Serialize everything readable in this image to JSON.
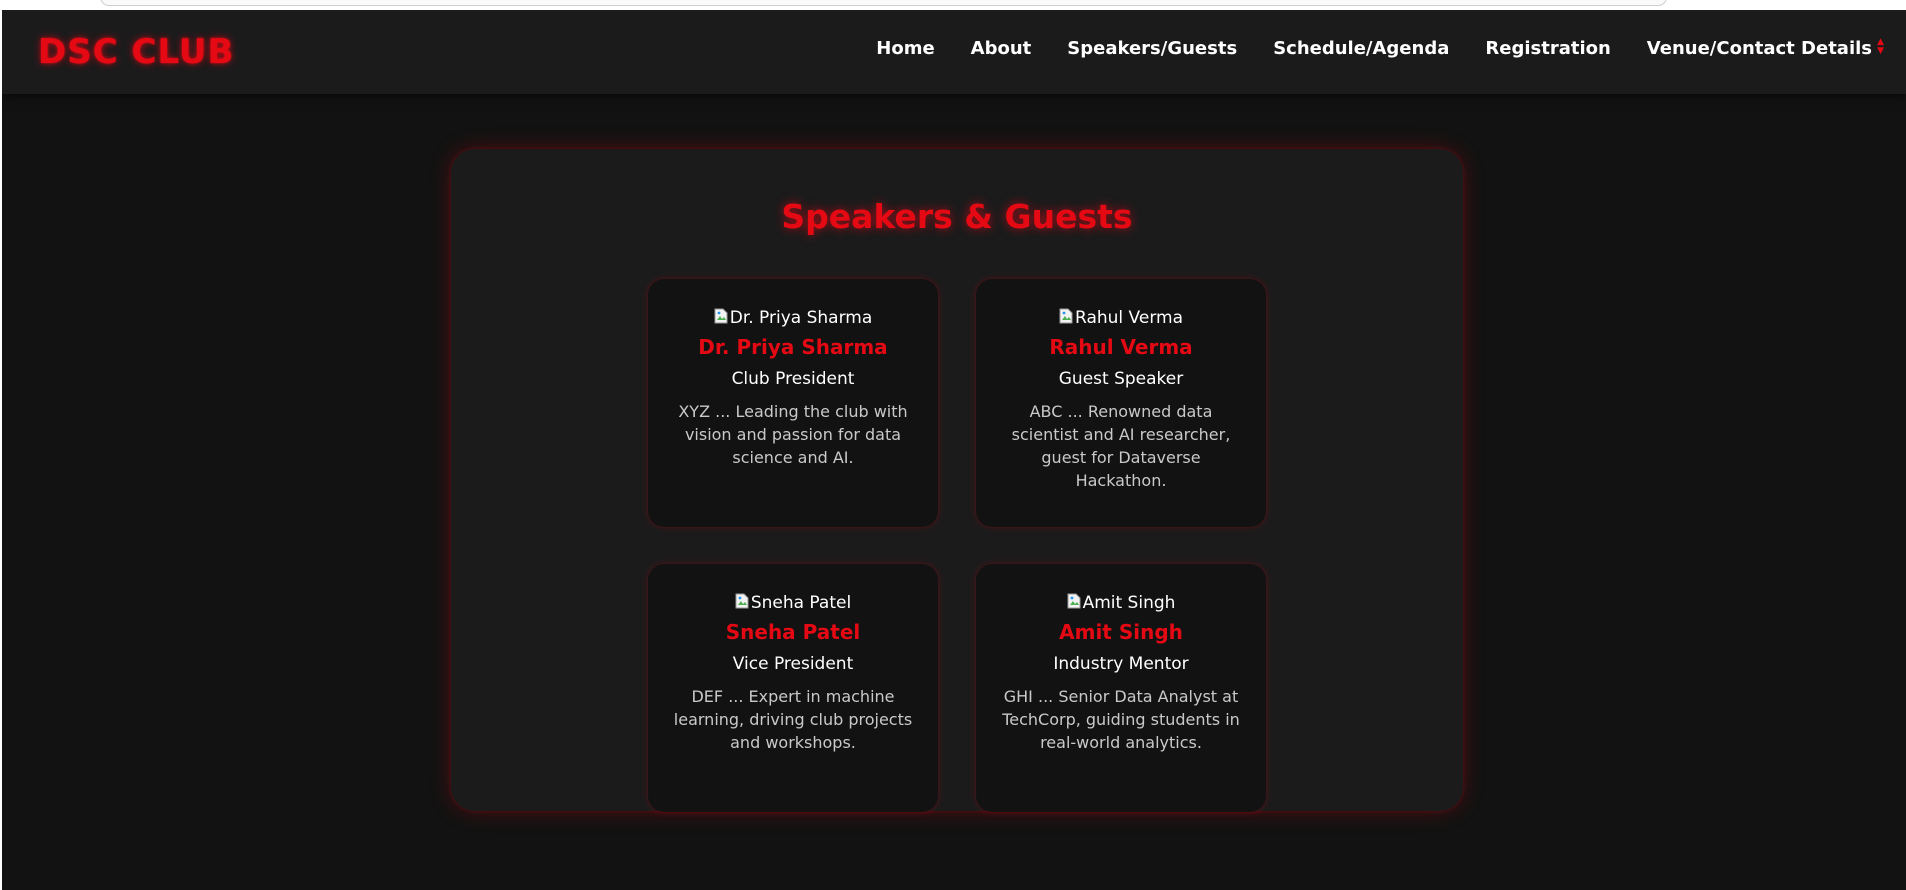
{
  "brand": "DSC CLUB",
  "nav": {
    "items": [
      "Home",
      "About",
      "Speakers/Guests",
      "Schedule/Agenda",
      "Registration",
      "Venue/Contact Details"
    ]
  },
  "section": {
    "title": "Speakers & Guests"
  },
  "speakers": [
    {
      "img_alt": "Dr. Priya Sharma",
      "name": "Dr. Priya Sharma",
      "role": "Club President",
      "bio": "XYZ ... Leading the club with vision and passion for data science and AI."
    },
    {
      "img_alt": "Rahul Verma",
      "name": "Rahul Verma",
      "role": "Guest Speaker",
      "bio": "ABC ... Renowned data scientist and AI researcher, guest for Dataverse Hackathon."
    },
    {
      "img_alt": "Sneha Patel",
      "name": "Sneha Patel",
      "role": "Vice President",
      "bio": "DEF ... Expert in machine learning, driving club projects and workshops."
    },
    {
      "img_alt": "Amit Singh",
      "name": "Amit Singh",
      "role": "Industry Mentor",
      "bio": "GHI ... Senior Data Analyst at TechCorp, guiding students in real-world analytics."
    }
  ],
  "colors": {
    "accent": "#e50914",
    "page_bg": "#121212",
    "panel_bg": "#1b1b1c"
  },
  "icons": {
    "broken_image": "broken-image-icon",
    "nav_scroll": "scroll-arrows-icon"
  }
}
